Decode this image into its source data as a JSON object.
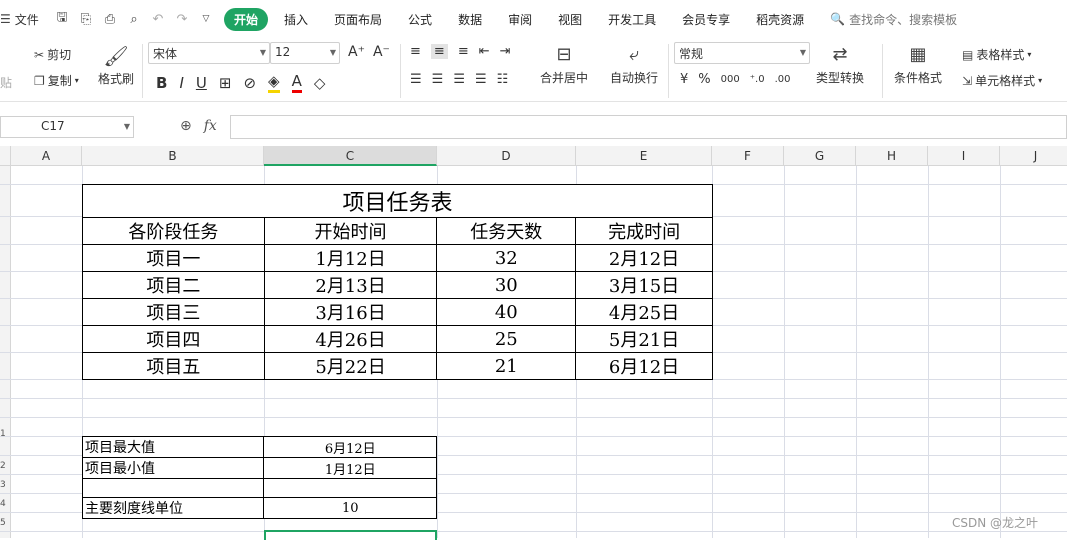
{
  "menu": {
    "file_label": "文件",
    "tabs": [
      "开始",
      "插入",
      "页面布局",
      "公式",
      "数据",
      "审阅",
      "视图",
      "开发工具",
      "会员专享",
      "稻壳资源"
    ],
    "active_tab": "开始",
    "search_placeholder": "查找命令、搜索模板"
  },
  "ribbon": {
    "paste_label": "贴",
    "cut_label": "剪切",
    "copy_label": "复制",
    "format_painter_label": "格式刷",
    "font_name": "宋体",
    "font_size": "12",
    "merge_label": "合并居中",
    "wrap_label": "自动换行",
    "number_format": "常规",
    "type_convert_label": "类型转换",
    "cond_format_label": "条件格式",
    "table_style_label": "表格样式",
    "cell_style_label": "单元格样式"
  },
  "formula_bar": {
    "cell_ref": "C17",
    "fx_label": "fx",
    "value": ""
  },
  "columns": [
    "A",
    "B",
    "C",
    "D",
    "E",
    "F",
    "G",
    "H",
    "I",
    "J"
  ],
  "selected_column": "C",
  "task_table": {
    "title": "项目任务表",
    "headers": [
      "各阶段任务",
      "开始时间",
      "任务天数",
      "完成时间"
    ],
    "rows": [
      [
        "项目一",
        "1月12日",
        "32",
        "2月12日"
      ],
      [
        "项目二",
        "2月13日",
        "30",
        "3月15日"
      ],
      [
        "项目三",
        "3月16日",
        "40",
        "4月25日"
      ],
      [
        "项目四",
        "4月26日",
        "25",
        "5月21日"
      ],
      [
        "项目五",
        "5月22日",
        "21",
        "6月12日"
      ]
    ]
  },
  "summary_table": {
    "rows": [
      [
        "项目最大值",
        "6月12日"
      ],
      [
        "项目最小值",
        "1月12日"
      ],
      [
        "",
        ""
      ],
      [
        "主要刻度线单位",
        "10"
      ]
    ]
  },
  "row_numbers": [
    "1",
    "2",
    "3",
    "4",
    "5"
  ],
  "watermark": "CSDN @龙之叶",
  "colors": {
    "accent": "#1fa463",
    "grid": "#dadde6"
  }
}
